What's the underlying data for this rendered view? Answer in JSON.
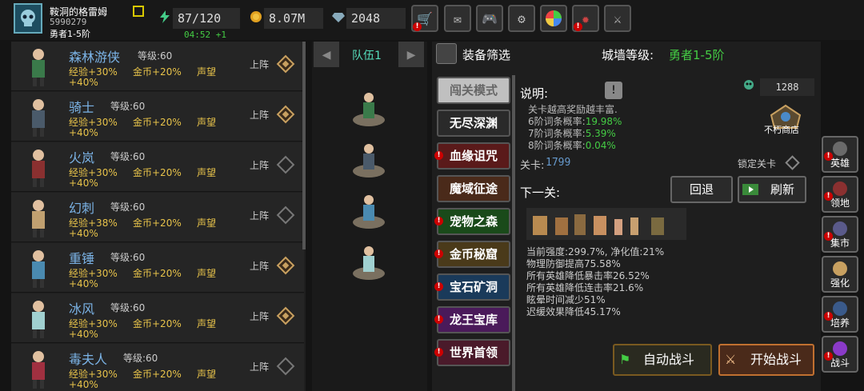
{
  "player": {
    "name": "鞍洞的格雷姆",
    "id": "5990279",
    "rank": "勇者1-5阶"
  },
  "stats": {
    "energy": "87/120",
    "timer": "04:52 +1",
    "gold": "8.07M",
    "gems": "2048"
  },
  "heroes": [
    {
      "name": "森林游侠",
      "level": "等级:60",
      "exp": "经验+30%",
      "gold": "金币+20%",
      "fame": "声望",
      "fame_bonus": "+40%",
      "deploy": "上阵",
      "deployed": true
    },
    {
      "name": "骑士",
      "level": "等级:60",
      "exp": "经验+30%",
      "gold": "金币+20%",
      "fame": "声望",
      "fame_bonus": "+40%",
      "deploy": "上阵",
      "deployed": true
    },
    {
      "name": "火岚",
      "level": "等级:60",
      "exp": "经验+30%",
      "gold": "金币+20%",
      "fame": "声望",
      "fame_bonus": "+40%",
      "deploy": "上阵",
      "deployed": false
    },
    {
      "name": "幻刺",
      "level": "等级:60",
      "exp": "经验+38%",
      "gold": "金币+20%",
      "fame": "声望",
      "fame_bonus": "+40%",
      "deploy": "上阵",
      "deployed": false
    },
    {
      "name": "重锤",
      "level": "等级:60",
      "exp": "经验+30%",
      "gold": "金币+20%",
      "fame": "声望",
      "fame_bonus": "+40%",
      "deploy": "上阵",
      "deployed": true
    },
    {
      "name": "冰风",
      "level": "等级:60",
      "exp": "经验+30%",
      "gold": "金币+20%",
      "fame": "声望",
      "fame_bonus": "+40%",
      "deploy": "上阵",
      "deployed": true
    },
    {
      "name": "毒夫人",
      "level": "等级:60",
      "exp": "经验+30%",
      "gold": "金币+20%",
      "fame": "声望",
      "fame_bonus": "+40%",
      "deploy": "上阵",
      "deployed": false
    }
  ],
  "team": {
    "title": "队伍1"
  },
  "panel": {
    "filter_label": "装备筛选",
    "wall_label": "城墙等级:",
    "wall_value": "勇者1-5阶"
  },
  "modes": [
    "闯关模式",
    "无尽深渊",
    "血缘诅咒",
    "魔域征途",
    "宠物之森",
    "金币秘窟",
    "宝石矿洞",
    "龙王宝库",
    "世界首领"
  ],
  "info": {
    "desc_label": "说明:",
    "desc_line1": "关卡越高奖励越丰富.",
    "tier6_label": "6阶词条概率:",
    "tier6_value": "19.98%",
    "tier7_label": "7阶词条概率:",
    "tier7_value": "5.39%",
    "tier8_label": "8阶词条概率:",
    "tier8_value": "0.04%",
    "stage_label": "关卡:",
    "stage_value": "1799",
    "lock_label": "锁定关卡",
    "next_label": "下一关:",
    "back_button": "回退",
    "refresh_button": "刷新",
    "effects": [
      "当前强度:299.7%, 净化值:21%",
      "物理防御提高75.58%",
      "所有英雄降低暴击率26.52%",
      "所有英雄降低连击率21.6%",
      "眩晕时间减少51%",
      "迟缓效果降低45.17%"
    ],
    "gem_count": "1288",
    "shop_label": "不朽商店",
    "auto_battle": "自动战斗",
    "start_battle": "开始战斗"
  },
  "sidenav": [
    "英雄",
    "领地",
    "集市",
    "强化",
    "培养",
    "战斗"
  ],
  "colors": {
    "accent_green": "#44cc44",
    "hero_name": "#7bb3e6",
    "bonus": "#e8c34a",
    "alert": "#cc0000"
  }
}
